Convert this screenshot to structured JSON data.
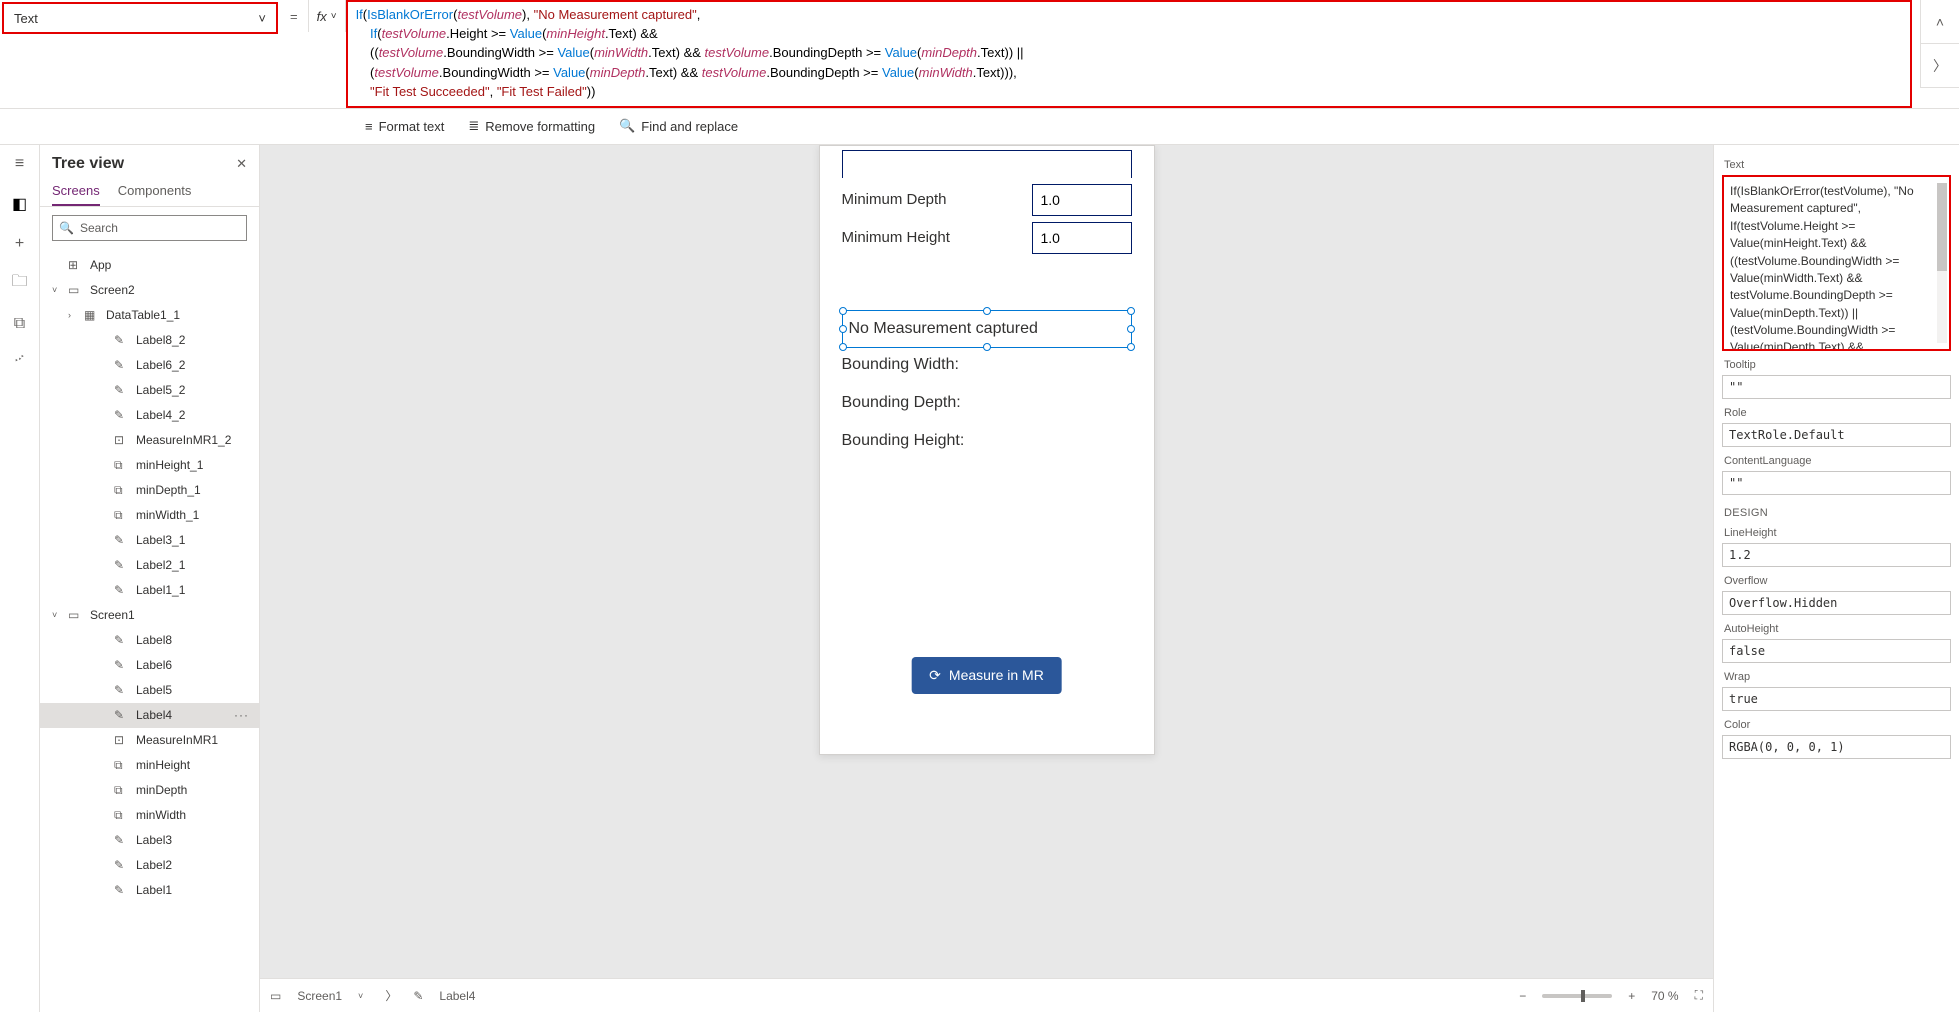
{
  "property_dropdown": {
    "label": "Text",
    "chevron": "˅"
  },
  "formula_bar": {
    "equals": "=",
    "fx": "fx",
    "code_html": "<span class='k'>If</span><span class='p'>(</span><span class='k'>IsBlankOrError</span><span class='p'>(</span><span class='v'>testVolume</span><span class='p'>),</span> <span class='s'>\"No Measurement captured\"</span><span class='p'>,</span>\n    <span class='k'>If</span><span class='p'>(</span><span class='v'>testVolume</span><span class='p'>.Height &gt;= </span><span class='k'>Value</span><span class='p'>(</span><span class='v'>minHeight</span><span class='p'>.Text) &amp;&amp;</span>\n    <span class='p'>((</span><span class='v'>testVolume</span><span class='p'>.BoundingWidth &gt;= </span><span class='k'>Value</span><span class='p'>(</span><span class='v'>minWidth</span><span class='p'>.Text) &amp;&amp; </span><span class='v'>testVolume</span><span class='p'>.BoundingDepth &gt;= </span><span class='k'>Value</span><span class='p'>(</span><span class='v'>minDepth</span><span class='p'>.Text)) ||</span>\n    <span class='p'>(</span><span class='v'>testVolume</span><span class='p'>.BoundingWidth &gt;= </span><span class='k'>Value</span><span class='p'>(</span><span class='v'>minDepth</span><span class='p'>.Text) &amp;&amp; </span><span class='v'>testVolume</span><span class='p'>.BoundingDepth &gt;= </span><span class='k'>Value</span><span class='p'>(</span><span class='v'>minWidth</span><span class='p'>.Text))),</span>\n    <span class='s'>\"Fit Test Succeeded\"</span><span class='p'>, </span><span class='s'>\"Fit Test Failed\"</span><span class='p'>))</span>",
    "collapse": "˄",
    "expand": "〉"
  },
  "sub_bar": {
    "format": "Format text",
    "remove": "Remove formatting",
    "find": "Find and replace"
  },
  "tree": {
    "title": "Tree view",
    "tabs": {
      "screens": "Screens",
      "components": "Components"
    },
    "search_placeholder": "Search",
    "nodes": [
      {
        "lvl": 0,
        "icon": "⊞",
        "label": "App",
        "caret": ""
      },
      {
        "lvl": 0,
        "icon": "▭",
        "label": "Screen2",
        "caret": "˅"
      },
      {
        "lvl": 1,
        "icon": "▦",
        "label": "DataTable1_1",
        "caret": "›"
      },
      {
        "lvl": 2,
        "icon": "✎",
        "label": "Label8_2"
      },
      {
        "lvl": 2,
        "icon": "✎",
        "label": "Label6_2"
      },
      {
        "lvl": 2,
        "icon": "✎",
        "label": "Label5_2"
      },
      {
        "lvl": 2,
        "icon": "✎",
        "label": "Label4_2"
      },
      {
        "lvl": 2,
        "icon": "⊡",
        "label": "MeasureInMR1_2"
      },
      {
        "lvl": 2,
        "icon": "⧉",
        "label": "minHeight_1"
      },
      {
        "lvl": 2,
        "icon": "⧉",
        "label": "minDepth_1"
      },
      {
        "lvl": 2,
        "icon": "⧉",
        "label": "minWidth_1"
      },
      {
        "lvl": 2,
        "icon": "✎",
        "label": "Label3_1"
      },
      {
        "lvl": 2,
        "icon": "✎",
        "label": "Label2_1"
      },
      {
        "lvl": 2,
        "icon": "✎",
        "label": "Label1_1"
      },
      {
        "lvl": 0,
        "icon": "▭",
        "label": "Screen1",
        "caret": "˅"
      },
      {
        "lvl": 2,
        "icon": "✎",
        "label": "Label8"
      },
      {
        "lvl": 2,
        "icon": "✎",
        "label": "Label6"
      },
      {
        "lvl": 2,
        "icon": "✎",
        "label": "Label5"
      },
      {
        "lvl": 2,
        "icon": "✎",
        "label": "Label4",
        "selected": true,
        "more": "···"
      },
      {
        "lvl": 2,
        "icon": "⊡",
        "label": "MeasureInMR1"
      },
      {
        "lvl": 2,
        "icon": "⧉",
        "label": "minHeight"
      },
      {
        "lvl": 2,
        "icon": "⧉",
        "label": "minDepth"
      },
      {
        "lvl": 2,
        "icon": "⧉",
        "label": "minWidth"
      },
      {
        "lvl": 2,
        "icon": "✎",
        "label": "Label3"
      },
      {
        "lvl": 2,
        "icon": "✎",
        "label": "Label2"
      },
      {
        "lvl": 2,
        "icon": "✎",
        "label": "Label1"
      }
    ]
  },
  "canvas": {
    "rows": [
      {
        "label": "Minimum Depth",
        "value": "1.0"
      },
      {
        "label": "Minimum Height",
        "value": "1.0"
      }
    ],
    "selected_text": "No Measurement captured",
    "out": [
      "Bounding Width:",
      "Bounding Depth:",
      "Bounding Height:"
    ],
    "button": "Measure in MR"
  },
  "footer": {
    "crumb1": "Screen1",
    "crumb2": "Label4",
    "zoom": "70 %",
    "minus": "−",
    "plus": "+"
  },
  "props": {
    "text_label": "Text",
    "text_code": "If(IsBlankOrError(testVolume), \"No\nMeasurement captured\",\nIf(testVolume.Height >=\nValue(minHeight.Text) &&\n((testVolume.BoundingWidth >=\nValue(minWidth.Text) &&\ntestVolume.BoundingDepth >=\nValue(minDepth.Text)) ||\n(testVolume.BoundingWidth >=\nValue(minDepth.Text) &&",
    "tooltip_label": "Tooltip",
    "tooltip_val": "\"\"",
    "role_label": "Role",
    "role_val": "TextRole.Default",
    "lang_label": "ContentLanguage",
    "lang_val": "\"\"",
    "design": "DESIGN",
    "lh_label": "LineHeight",
    "lh_val": "1.2",
    "ov_label": "Overflow",
    "ov_val": "Overflow.Hidden",
    "ah_label": "AutoHeight",
    "ah_val": "false",
    "wrap_label": "Wrap",
    "wrap_val": "true",
    "color_label": "Color",
    "color_val": "RGBA(0, 0, 0, 1)"
  }
}
